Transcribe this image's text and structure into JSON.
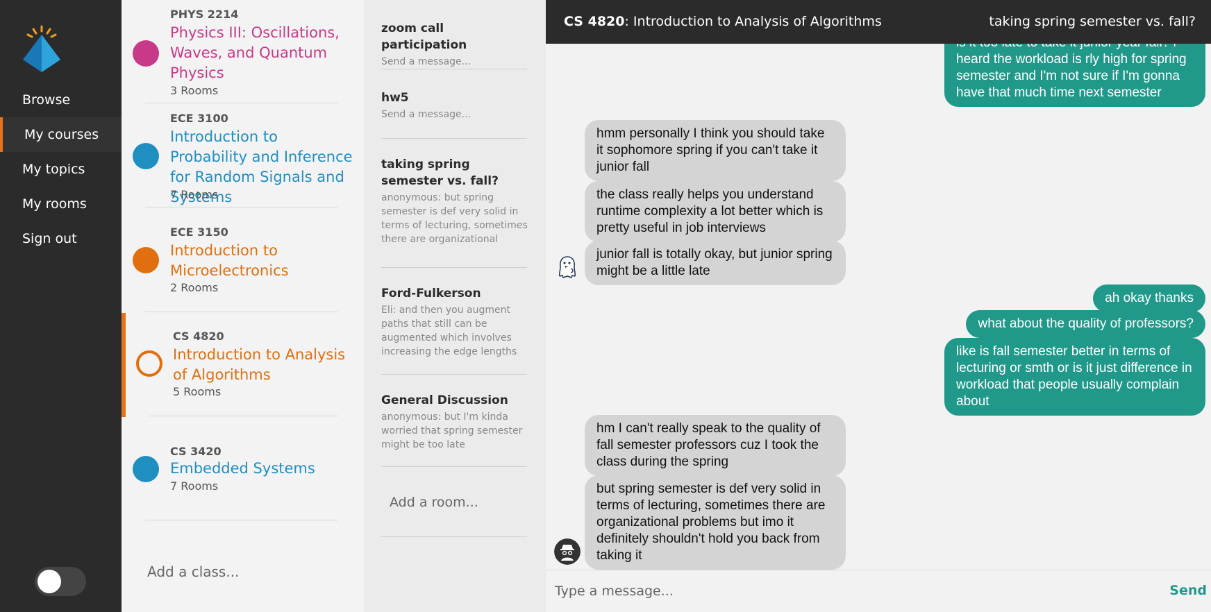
{
  "nav": {
    "items": [
      {
        "label": "Browse"
      },
      {
        "label": "My courses"
      },
      {
        "label": "My topics"
      },
      {
        "label": "My rooms"
      },
      {
        "label": "Sign out"
      }
    ],
    "active_index": 1
  },
  "courses": {
    "items": [
      {
        "code": "PHYS 2214",
        "name": "Physics III: Oscillations, Waves, and Quantum Physics",
        "rooms": "3 Rooms",
        "color": "#c73a88",
        "filled": true
      },
      {
        "code": "ECE 3100",
        "name": "Introduction to Probability and Inference for Random Signals and Systems",
        "rooms": "7 Rooms",
        "color": "#1f8fc2",
        "filled": true
      },
      {
        "code": "ECE 3150",
        "name": "Introduction to Microelectronics",
        "rooms": "2 Rooms",
        "color": "#e0700f",
        "filled": true
      },
      {
        "code": "CS 4820",
        "name": "Introduction to Analysis of Algorithms",
        "rooms": "5 Rooms",
        "color": "#e0700f",
        "filled": false
      },
      {
        "code": "CS 3420",
        "name": "Embedded Systems",
        "rooms": "7 Rooms",
        "color": "#1f8fc2",
        "filled": true
      }
    ],
    "add_placeholder": "Add a class..."
  },
  "rooms": {
    "items": [
      {
        "name": "zoom call participation",
        "preview": "Send a message..."
      },
      {
        "name": "hw5",
        "preview": "Send a message..."
      },
      {
        "name": "taking spring semester vs. fall?",
        "preview": "anonymous: but spring semester is def very solid in terms of lecturing, sometimes there are organizational problems but imo it definitely shouldn't hold you back from taking it"
      },
      {
        "name": "Ford-Fulkerson",
        "preview": "Eli: and then you augment paths that still can be augmented which involves increasing the edge lengths"
      },
      {
        "name": "General Discussion",
        "preview": "anonymous: but I'm kinda worried that spring semester might be too late"
      }
    ],
    "add_placeholder": "Add a room..."
  },
  "chat": {
    "header_code": "CS 4820",
    "header_title": ": Introduction to Analysis of Algorithms",
    "topic": "taking spring semester vs. fall?",
    "messages": [
      {
        "side": "out",
        "text": "is it too late to take it junior year fall? i heard the workload is rly high for spring semester and I'm not sure if I'm gonna have that much time next semester"
      },
      {
        "side": "in",
        "text": "hmm personally I think you should take it sophomore spring if you can't take it junior fall"
      },
      {
        "side": "in",
        "text": "the class really helps you understand runtime complexity a lot better which is pretty useful in job interviews"
      },
      {
        "side": "in",
        "text": "junior fall is totally okay, but junior spring might be a little late"
      },
      {
        "side": "out",
        "text": "ah okay thanks"
      },
      {
        "side": "out",
        "text": "what about the quality of professors?"
      },
      {
        "side": "out",
        "text": "like is fall semester better in terms of lecturing or smth or is it just difference in workload that people usually complain about"
      },
      {
        "side": "in",
        "text": "hm I can't really speak to the quality of fall semester professors cuz I took the class during the spring"
      },
      {
        "side": "in",
        "text": "but spring semester is def very solid in terms of lecturing, sometimes there are organizational problems but imo it definitely shouldn't hold you back from taking it"
      }
    ],
    "input_placeholder": "Type a message...",
    "send_label": "Send"
  },
  "colors": {
    "accent": "#e6731a",
    "outgoing_bubble": "#21998a",
    "incoming_bubble": "#d4d4d4"
  }
}
